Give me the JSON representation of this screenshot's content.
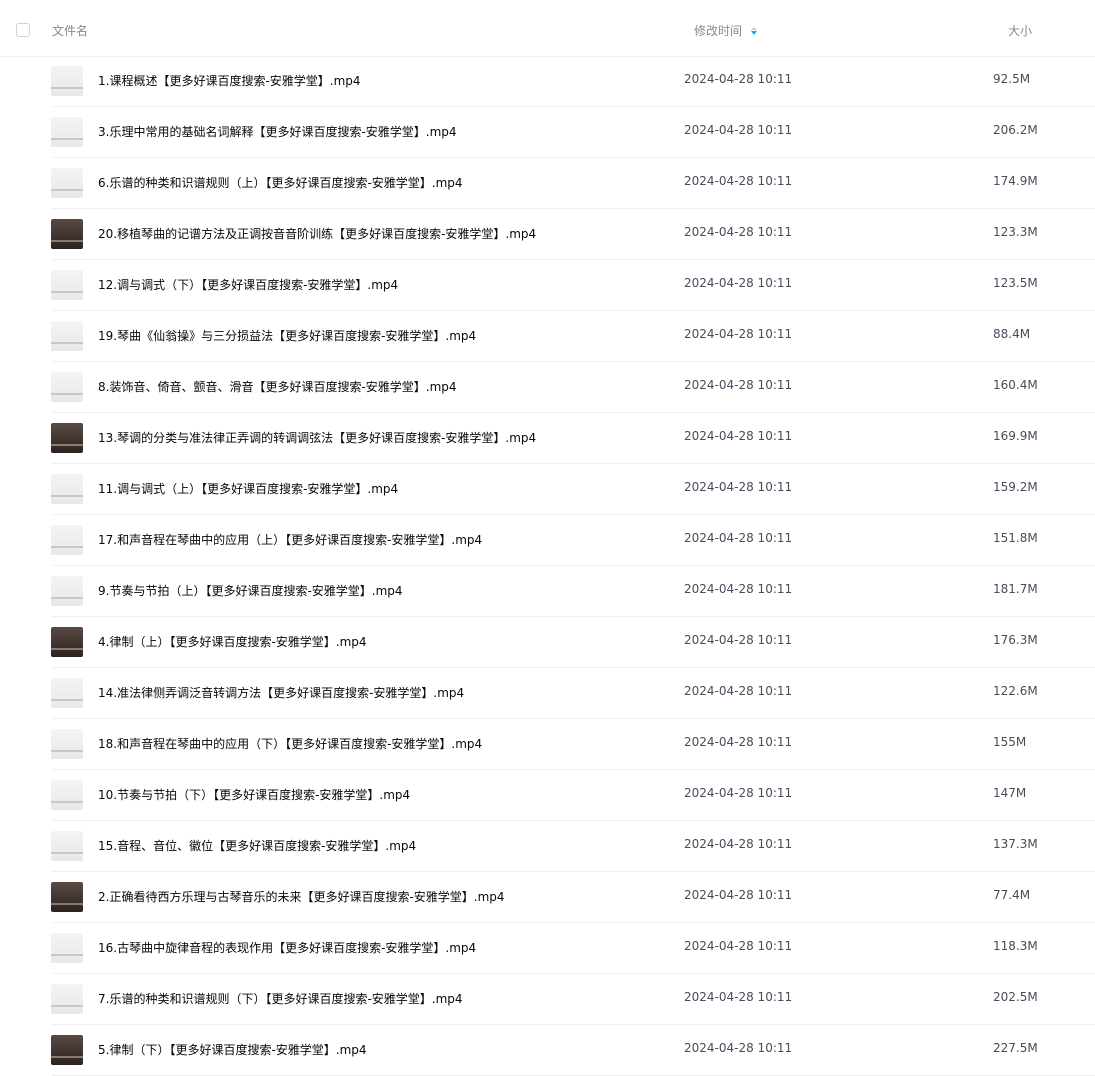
{
  "header": {
    "name_label": "文件名",
    "time_label": "修改时间",
    "size_label": "大小"
  },
  "files": [
    {
      "name": "1.课程概述【更多好课百度搜索-安雅学堂】.mp4",
      "time": "2024-04-28 10:11",
      "size": "92.5M",
      "thumb": "light"
    },
    {
      "name": "3.乐理中常用的基础名词解释【更多好课百度搜索-安雅学堂】.mp4",
      "time": "2024-04-28 10:11",
      "size": "206.2M",
      "thumb": "light"
    },
    {
      "name": "6.乐谱的种类和识谱规则（上）【更多好课百度搜索-安雅学堂】.mp4",
      "time": "2024-04-28 10:11",
      "size": "174.9M",
      "thumb": "light"
    },
    {
      "name": "20.移植琴曲的记谱方法及正调按音音阶训练【更多好课百度搜索-安雅学堂】.mp4",
      "time": "2024-04-28 10:11",
      "size": "123.3M",
      "thumb": "dark"
    },
    {
      "name": "12.调与调式（下）【更多好课百度搜索-安雅学堂】.mp4",
      "time": "2024-04-28 10:11",
      "size": "123.5M",
      "thumb": "light"
    },
    {
      "name": "19.琴曲《仙翁操》与三分损益法【更多好课百度搜索-安雅学堂】.mp4",
      "time": "2024-04-28 10:11",
      "size": "88.4M",
      "thumb": "light"
    },
    {
      "name": "8.装饰音、倚音、颤音、滑音【更多好课百度搜索-安雅学堂】.mp4",
      "time": "2024-04-28 10:11",
      "size": "160.4M",
      "thumb": "light"
    },
    {
      "name": "13.琴调的分类与准法律正弄调的转调调弦法【更多好课百度搜索-安雅学堂】.mp4",
      "time": "2024-04-28 10:11",
      "size": "169.9M",
      "thumb": "dark"
    },
    {
      "name": "11.调与调式（上）【更多好课百度搜索-安雅学堂】.mp4",
      "time": "2024-04-28 10:11",
      "size": "159.2M",
      "thumb": "light"
    },
    {
      "name": "17.和声音程在琴曲中的应用（上）【更多好课百度搜索-安雅学堂】.mp4",
      "time": "2024-04-28 10:11",
      "size": "151.8M",
      "thumb": "light"
    },
    {
      "name": "9.节奏与节拍（上）【更多好课百度搜索-安雅学堂】.mp4",
      "time": "2024-04-28 10:11",
      "size": "181.7M",
      "thumb": "light"
    },
    {
      "name": "4.律制（上）【更多好课百度搜索-安雅学堂】.mp4",
      "time": "2024-04-28 10:11",
      "size": "176.3M",
      "thumb": "dark"
    },
    {
      "name": "14.准法律侧弄调泛音转调方法【更多好课百度搜索-安雅学堂】.mp4",
      "time": "2024-04-28 10:11",
      "size": "122.6M",
      "thumb": "light"
    },
    {
      "name": "18.和声音程在琴曲中的应用（下）【更多好课百度搜索-安雅学堂】.mp4",
      "time": "2024-04-28 10:11",
      "size": "155M",
      "thumb": "light"
    },
    {
      "name": "10.节奏与节拍（下）【更多好课百度搜索-安雅学堂】.mp4",
      "time": "2024-04-28 10:11",
      "size": "147M",
      "thumb": "light"
    },
    {
      "name": "15.音程、音位、徽位【更多好课百度搜索-安雅学堂】.mp4",
      "time": "2024-04-28 10:11",
      "size": "137.3M",
      "thumb": "light"
    },
    {
      "name": "2.正确看待西方乐理与古琴音乐的未来【更多好课百度搜索-安雅学堂】.mp4",
      "time": "2024-04-28 10:11",
      "size": "77.4M",
      "thumb": "dark"
    },
    {
      "name": "16.古琴曲中旋律音程的表现作用【更多好课百度搜索-安雅学堂】.mp4",
      "time": "2024-04-28 10:11",
      "size": "118.3M",
      "thumb": "light"
    },
    {
      "name": "7.乐谱的种类和识谱规则（下）【更多好课百度搜索-安雅学堂】.mp4",
      "time": "2024-04-28 10:11",
      "size": "202.5M",
      "thumb": "light"
    },
    {
      "name": "5.律制（下）【更多好课百度搜索-安雅学堂】.mp4",
      "time": "2024-04-28 10:11",
      "size": "227.5M",
      "thumb": "dark"
    }
  ]
}
